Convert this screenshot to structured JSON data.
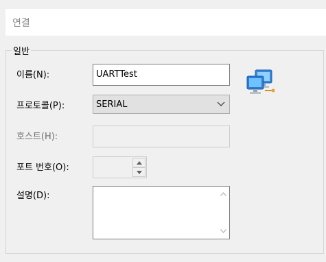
{
  "header": {
    "title": "연결"
  },
  "group": {
    "legend": "일반"
  },
  "fields": {
    "name": {
      "label": "이름(N):",
      "value": "UARTTest"
    },
    "protocol": {
      "label": "프로토콜(P):",
      "value": "SERIAL"
    },
    "host": {
      "label": "호스트(H):",
      "value": ""
    },
    "port": {
      "label": "포트 번호(O):",
      "value": ""
    },
    "description": {
      "label": "설명(D):",
      "value": ""
    }
  },
  "icons": {
    "session_icon": "network-computers-icon",
    "dropdown": "chevron-down-icon",
    "spin_up": "triangle-up-icon",
    "spin_down": "triangle-down-icon"
  },
  "colors": {
    "window_bg": "#f0f0f0",
    "input_border": "#7a7a7a",
    "disabled_text": "#6d6d6d",
    "icon_blue": "#2b7bd8"
  }
}
